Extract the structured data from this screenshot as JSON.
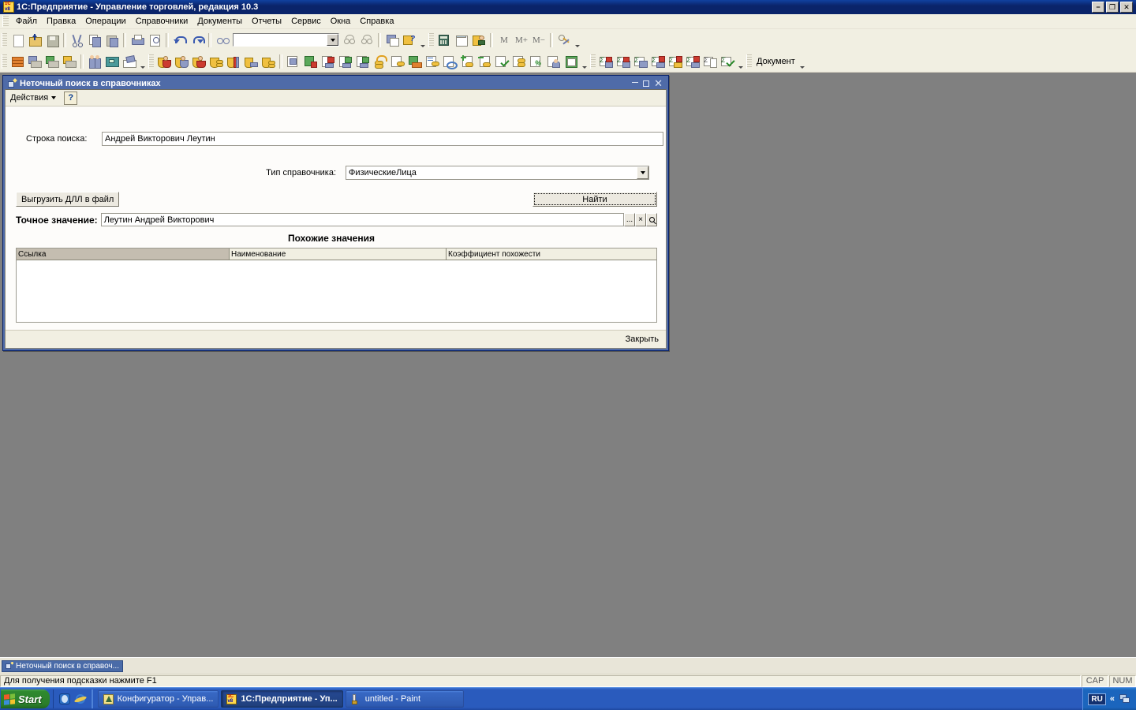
{
  "window": {
    "title": "1С:Предприятие - Управление торговлей, редакция 10.3",
    "icon": "1c-app-icon",
    "minimize": "−",
    "maximize": "❐",
    "close": "✕"
  },
  "menu": {
    "items": [
      {
        "label": "Файл",
        "accel": "Ф"
      },
      {
        "label": "Правка",
        "accel": "П"
      },
      {
        "label": "Операции",
        "accel": ""
      },
      {
        "label": "Справочники",
        "accel": ""
      },
      {
        "label": "Документы",
        "accel": ""
      },
      {
        "label": "Отчеты",
        "accel": ""
      },
      {
        "label": "Сервис",
        "accel": "С"
      },
      {
        "label": "Окна",
        "accel": "О"
      },
      {
        "label": "Справка",
        "accel": ""
      }
    ]
  },
  "toolbar_main": {
    "combo_value": "",
    "buttons": [
      "new-document-icon",
      "open-folder-icon",
      "save-icon",
      "cut-icon",
      "copy-icon",
      "paste-icon",
      "print-icon",
      "print-preview-icon",
      "undo-icon",
      "redo-icon",
      "find-icon"
    ],
    "buttons_right": [
      "find-next-icon",
      "find-prev-icon",
      "switch-window-icon",
      "help-1c-icon",
      "calculator-icon",
      "calendar-icon",
      "user-settings-icon"
    ],
    "markers": [
      "M",
      "M+",
      "M−"
    ],
    "tools_icon": "tools-icon"
  },
  "toolbar_second": {
    "group1": [
      "books-icon",
      "report-print-icon",
      "report-icon",
      "report-card-icon"
    ],
    "group2": [
      "persons-icon",
      "cashbox-icon",
      "cash-register-icon"
    ],
    "group3": [
      "client-icon",
      "purchase-icon",
      "sale-icon",
      "money-icon",
      "warehouse-icon",
      "payment-icon",
      "coins-icon"
    ],
    "group4": [
      "invoice-icon",
      "invoice-flag-icon",
      "invoice-green-icon",
      "invoice-red-icon",
      "invoice-red2-icon",
      "coins-refresh-icon",
      "doc-money-icon",
      "goods-icon",
      "doc-list-icon",
      "doc-sync-icon",
      "doc-add-icon",
      "doc-remove-icon",
      "doc-check-icon",
      "doc-coins-icon",
      "doc-percent-icon",
      "doc-person-icon",
      "excel-icon"
    ],
    "group5": [
      "env-person-icon",
      "env-person2-icon",
      "env-group-icon",
      "env-flag-icon",
      "env-flag2-icon",
      "env-flag3-icon",
      "env-copy-icon",
      "env-check-icon"
    ],
    "label": "Документ"
  },
  "dialog": {
    "title": "Неточный поиск в справочниках",
    "icon": "search-dialog-icon",
    "caption_buttons": {
      "minimize": "minimize-icon",
      "maximize": "maximize-icon",
      "close": "close-icon"
    },
    "toolbar": {
      "actions_label": "Действия",
      "help_label": "?"
    },
    "search_string_label": "Строка поиска:",
    "search_string_value": "Андрей Викторович Леутин",
    "catalog_type_label": "Тип справочника:",
    "catalog_type_value": "ФизическиеЛица",
    "export_dll_button": "Выгрузить ДЛЛ в файл",
    "find_button": "Найти",
    "exact_value_label": "Точное значение:",
    "exact_value": "Леутин Андрей Викторович",
    "exact_value_buttons": {
      "select": "...",
      "clear": "×",
      "open": "search-icon"
    },
    "similar_values_title": "Похожие значения",
    "grid": {
      "columns": [
        "Ссылка",
        "Наименование",
        "Коэффициент похожести"
      ],
      "rows": []
    },
    "close_button": "Закрыть"
  },
  "window_list": [
    {
      "label": "Неточный поиск в справоч...",
      "icon": "search-dialog-icon",
      "active": true
    }
  ],
  "statusbar": {
    "message": "Для получения подсказки нажмите F1",
    "caps": "CAP",
    "num": "NUM"
  },
  "taskbar": {
    "start_label": "Start",
    "quick_launch": [
      "ie-blue-icon",
      "ie-explorer-icon"
    ],
    "tasks": [
      {
        "label": "Конфигуратор - Управ...",
        "icon": "configurator-icon",
        "active": false
      },
      {
        "label": "1С:Предприятие - Уп...",
        "icon": "1c-app-icon",
        "active": true
      },
      {
        "label": "untitled - Paint",
        "icon": "paint-icon",
        "active": false
      }
    ],
    "tray": {
      "language": "RU",
      "expand": "«",
      "network_icon": "network-icon"
    }
  },
  "colors": {
    "titlebar": "#0a246a",
    "dialog_border": "#4f6ba8",
    "desktop": "#808080",
    "toolbar_bg": "#f1efe2",
    "dialog_bg": "#fdfcfa",
    "taskbar": "#2a5bbd"
  }
}
